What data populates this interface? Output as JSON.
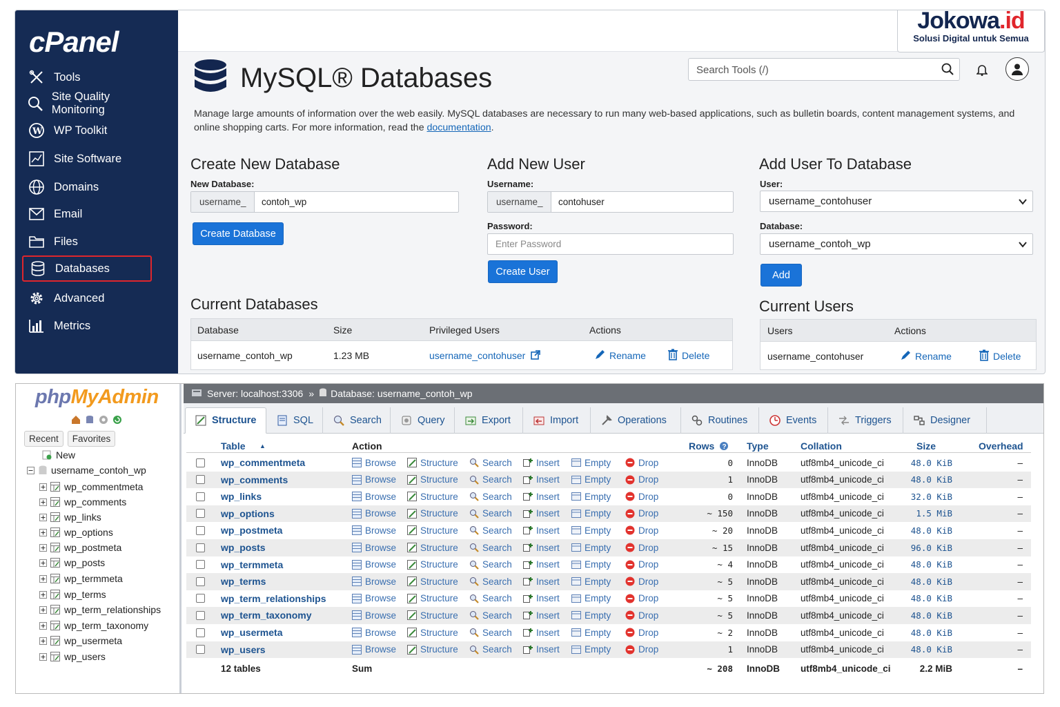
{
  "cpanel": {
    "logo": "cPanel",
    "nav": [
      {
        "label": "Tools",
        "icon": "tools-icon"
      },
      {
        "label": "Site Quality Monitoring",
        "icon": "search-icon"
      },
      {
        "label": "WP Toolkit",
        "icon": "wordpress-icon"
      },
      {
        "label": "Site Software",
        "icon": "chart-board-icon"
      },
      {
        "label": "Domains",
        "icon": "globe-icon"
      },
      {
        "label": "Email",
        "icon": "envelope-icon"
      },
      {
        "label": "Files",
        "icon": "folder-icon"
      },
      {
        "label": "Databases",
        "icon": "database-icon",
        "selected": true
      },
      {
        "label": "Advanced",
        "icon": "gear-icon"
      },
      {
        "label": "Metrics",
        "icon": "bar-chart-icon"
      }
    ],
    "brand": {
      "name_a": "Jokowa",
      "name_b": ".id",
      "tagline": "Solusi Digital untuk Semua"
    },
    "search_placeholder": "Search Tools (/)",
    "title": "MySQL® Databases",
    "description_a": "Manage large amounts of information over the web easily. MySQL databases are necessary to run many web-based applications, such as bulletin boards, content management systems, and online shopping carts. For more information, read the ",
    "description_link": "documentation",
    "description_b": ".",
    "create_db": {
      "heading": "Create New Database",
      "label": "New Database:",
      "prefix": "username_",
      "value": "contoh_wp",
      "button": "Create Database"
    },
    "add_user": {
      "heading": "Add New User",
      "username_label": "Username:",
      "prefix": "username_",
      "value": "contohuser",
      "password_label": "Password:",
      "password_placeholder": "Enter Password",
      "button": "Create User"
    },
    "user_to_db": {
      "heading": "Add User To Database",
      "user_label": "User:",
      "user_value": "username_contohuser",
      "db_label": "Database:",
      "db_value": "username_contoh_wp",
      "button": "Add"
    },
    "current_dbs": {
      "heading": "Current Databases",
      "columns": [
        "Database",
        "Size",
        "Privileged Users",
        "Actions"
      ],
      "row": {
        "database": "username_contoh_wp",
        "size": "1.23 MB",
        "user": "username_contohuser",
        "rename": "Rename",
        "delete": "Delete"
      }
    },
    "current_users": {
      "heading": "Current Users",
      "columns": [
        "Users",
        "Actions"
      ],
      "row": {
        "user": "username_contohuser",
        "rename": "Rename",
        "delete": "Delete"
      }
    }
  },
  "pma": {
    "logo_a": "php",
    "logo_b": "MyAdmin",
    "tab_recent": "Recent",
    "tab_favorites": "Favorites",
    "tree_new": "New",
    "tree_db": "username_contoh_wp",
    "breadcrumb_server": "Server: localhost:3306",
    "breadcrumb_sep": "»",
    "breadcrumb_db": "Database: username_contoh_wp",
    "tabs": [
      "Structure",
      "SQL",
      "Search",
      "Query",
      "Export",
      "Import",
      "Operations",
      "Routines",
      "Events",
      "Triggers",
      "Designer"
    ],
    "columns": {
      "table": "Table",
      "sort": "▲",
      "action": "Action",
      "rows": "Rows",
      "type": "Type",
      "collation": "Collation",
      "size": "Size",
      "overhead": "Overhead"
    },
    "actions": [
      "Browse",
      "Structure",
      "Search",
      "Insert",
      "Empty",
      "Drop"
    ],
    "tables": [
      {
        "name": "wp_commentmeta",
        "rows": "0",
        "type": "InnoDB",
        "collation": "utf8mb4_unicode_ci",
        "size": "48.0 KiB",
        "overhead": "–"
      },
      {
        "name": "wp_comments",
        "rows": "1",
        "type": "InnoDB",
        "collation": "utf8mb4_unicode_ci",
        "size": "48.0 KiB",
        "overhead": "–"
      },
      {
        "name": "wp_links",
        "rows": "0",
        "type": "InnoDB",
        "collation": "utf8mb4_unicode_ci",
        "size": "32.0 KiB",
        "overhead": "–"
      },
      {
        "name": "wp_options",
        "rows": "~ 150",
        "type": "InnoDB",
        "collation": "utf8mb4_unicode_ci",
        "size": "1.5 MiB",
        "overhead": "–"
      },
      {
        "name": "wp_postmeta",
        "rows": "~ 20",
        "type": "InnoDB",
        "collation": "utf8mb4_unicode_ci",
        "size": "48.0 KiB",
        "overhead": "–"
      },
      {
        "name": "wp_posts",
        "rows": "~ 15",
        "type": "InnoDB",
        "collation": "utf8mb4_unicode_ci",
        "size": "96.0 KiB",
        "overhead": "–"
      },
      {
        "name": "wp_termmeta",
        "rows": "~ 4",
        "type": "InnoDB",
        "collation": "utf8mb4_unicode_ci",
        "size": "48.0 KiB",
        "overhead": "–"
      },
      {
        "name": "wp_terms",
        "rows": "~ 5",
        "type": "InnoDB",
        "collation": "utf8mb4_unicode_ci",
        "size": "48.0 KiB",
        "overhead": "–"
      },
      {
        "name": "wp_term_relationships",
        "rows": "~ 5",
        "type": "InnoDB",
        "collation": "utf8mb4_unicode_ci",
        "size": "48.0 KiB",
        "overhead": "–"
      },
      {
        "name": "wp_term_taxonomy",
        "rows": "~ 5",
        "type": "InnoDB",
        "collation": "utf8mb4_unicode_ci",
        "size": "48.0 KiB",
        "overhead": "–"
      },
      {
        "name": "wp_usermeta",
        "rows": "~ 2",
        "type": "InnoDB",
        "collation": "utf8mb4_unicode_ci",
        "size": "48.0 KiB",
        "overhead": "–"
      },
      {
        "name": "wp_users",
        "rows": "1",
        "type": "InnoDB",
        "collation": "utf8mb4_unicode_ci",
        "size": "48.0 KiB",
        "overhead": "–"
      }
    ],
    "summary": {
      "count": "12 tables",
      "label": "Sum",
      "rows": "~ 208",
      "type": "InnoDB",
      "collation": "utf8mb4_unicode_ci",
      "size": "2.2 MiB",
      "overhead": "–"
    }
  }
}
